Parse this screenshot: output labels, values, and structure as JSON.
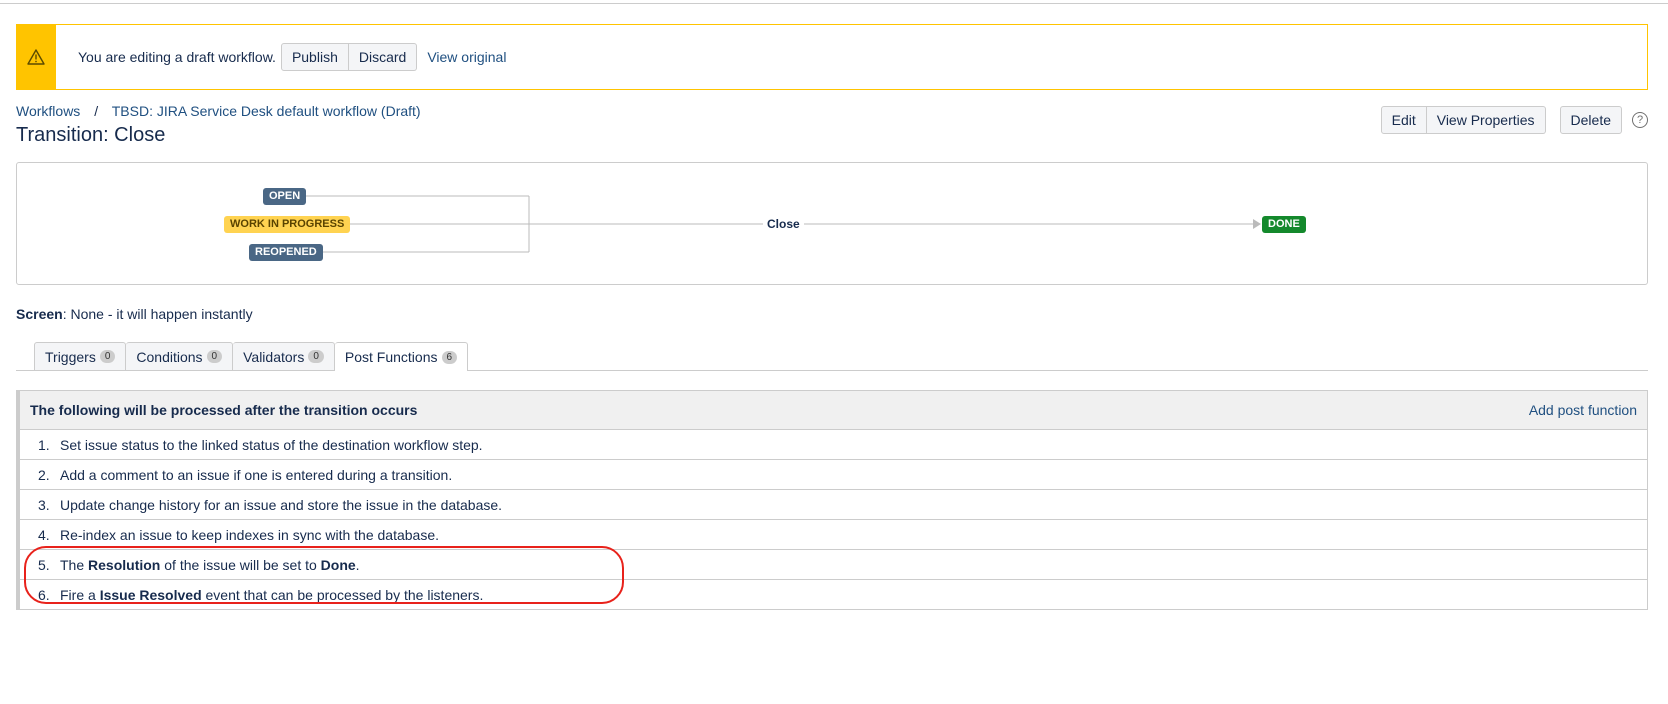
{
  "banner": {
    "message": "You are editing a draft workflow.",
    "publish_label": "Publish",
    "discard_label": "Discard",
    "view_original_label": "View original",
    "accent_color": "#ffc400"
  },
  "breadcrumb": {
    "root": "Workflows",
    "separator": "/",
    "workflow": "TBSD: JIRA Service Desk default workflow (Draft)"
  },
  "page_title": "Transition: Close",
  "actions": {
    "edit_label": "Edit",
    "view_properties_label": "View Properties",
    "delete_label": "Delete",
    "help_symbol": "?"
  },
  "diagram": {
    "sources": [
      "OPEN",
      "WORK IN PROGRESS",
      "REOPENED"
    ],
    "transition": "Close",
    "destination": "DONE"
  },
  "screen": {
    "label": "Screen",
    "value": ": None - it will happen instantly"
  },
  "tabs": [
    {
      "label": "Triggers",
      "count": "0"
    },
    {
      "label": "Conditions",
      "count": "0"
    },
    {
      "label": "Validators",
      "count": "0"
    },
    {
      "label": "Post Functions",
      "count": "6"
    }
  ],
  "post_functions": {
    "header": "The following will be processed after the transition occurs",
    "add_label": "Add post function",
    "items": [
      {
        "num": "1.",
        "text": "Set issue status to the linked status of the destination workflow step."
      },
      {
        "num": "2.",
        "text": "Add a comment to an issue if one is entered during a transition."
      },
      {
        "num": "3.",
        "text": "Update change history for an issue and store the issue in the database."
      },
      {
        "num": "4.",
        "text": "Re-index an issue to keep indexes in sync with the database."
      },
      {
        "num": "5.",
        "pre": "The ",
        "bold1": "Resolution",
        "mid": " of the issue will be set to ",
        "bold2": "Done",
        "post": "."
      },
      {
        "num": "6.",
        "pre": "Fire a ",
        "bold1": "Issue Resolved",
        "post": " event that can be processed by the listeners."
      }
    ]
  },
  "colors": {
    "link": "#205081",
    "highlight": "#e8221b",
    "status_blue": "#4a6785",
    "status_yellow": "#ffd351",
    "status_green": "#14892c"
  }
}
